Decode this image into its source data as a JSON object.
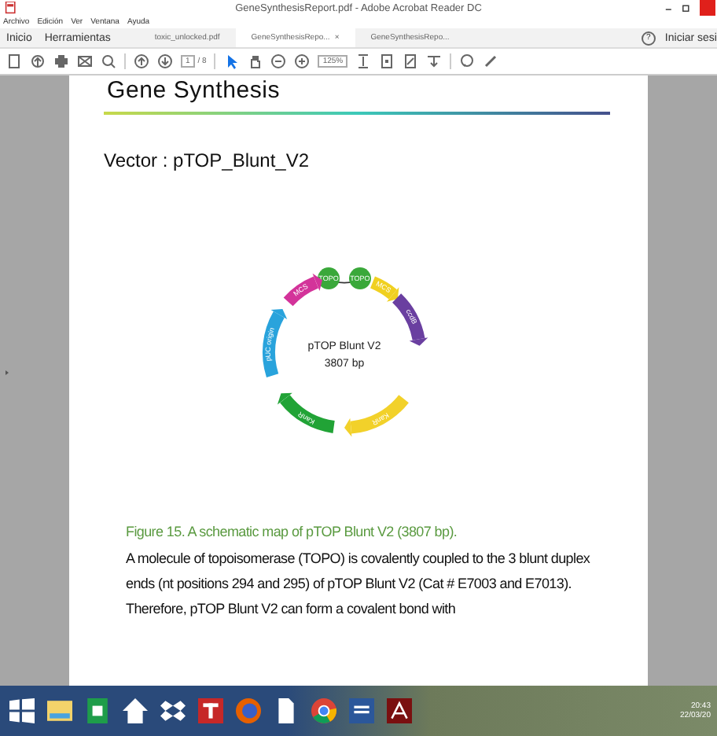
{
  "window": {
    "title": "GeneSynthesisReport.pdf - Adobe Acrobat Reader DC"
  },
  "menu": [
    "Archivo",
    "Edición",
    "Ver",
    "Ventana",
    "Ayuda"
  ],
  "nav": [
    "Inicio",
    "Herramientas"
  ],
  "tabs": [
    {
      "label": "toxic_unlocked.pdf",
      "selected": false
    },
    {
      "label": "GeneSynthesisRepo...",
      "selected": true,
      "close": "×"
    },
    {
      "label": "GeneSynthesisRepo...",
      "selected": false
    }
  ],
  "help": "?",
  "sign_in": "Iniciar sesi",
  "toolbar": {
    "page": "1",
    "pages": "/ 8",
    "zoom": "125%"
  },
  "document": {
    "heading": "Gene Synthesis",
    "vector": "Vector : pTOP_Blunt_V2",
    "plasmid": {
      "name": "pTOP Blunt V2",
      "size": "3807 bp",
      "features": [
        {
          "label": "TOPO",
          "kind": "ball",
          "color": "#3aa83a"
        },
        {
          "label": "TOPO",
          "kind": "ball",
          "color": "#3aa83a"
        },
        {
          "label": "MCS",
          "kind": "arrow",
          "color": "#f0d020"
        },
        {
          "label": "ccdB",
          "kind": "arrow",
          "color": "#6a3fa0"
        },
        {
          "label": "KanR",
          "kind": "arrow",
          "color": "#f2d12a"
        },
        {
          "label": "KanR",
          "kind": "arrow",
          "color": "#21a336"
        },
        {
          "label": "pUC origin",
          "kind": "arrow",
          "color": "#29a3dc"
        },
        {
          "label": "MCS",
          "kind": "arrow",
          "color": "#d3339a"
        }
      ]
    },
    "caption": "Figure 15. A schematic map of pTOP Blunt V2 (3807 bp).",
    "paragraph": "A molecule of topoisomerase (TOPO) is covalently coupled to the 3 blunt duplex ends (nt positions 294 and 295) of pTOP Blunt V2 (Cat # E7003 and E7013). Therefore, pTOP Blunt V2 can form a covalent bond with"
  },
  "taskbar": {
    "time": "20:43",
    "date": "22/03/20"
  }
}
